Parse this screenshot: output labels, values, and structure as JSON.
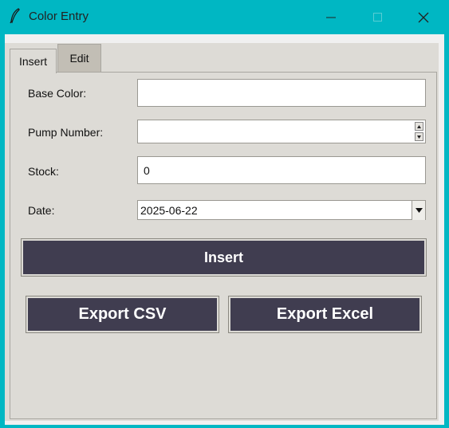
{
  "window": {
    "title": "Color Entry",
    "accent_color": "#00b7c3",
    "icon": "feather-icon"
  },
  "tabs": [
    {
      "label": "Insert",
      "selected": true
    },
    {
      "label": "Edit",
      "selected": false
    }
  ],
  "form": {
    "base_color": {
      "label": "Base Color:",
      "value": ""
    },
    "pump_number": {
      "label": "Pump Number:",
      "value": ""
    },
    "stock": {
      "label": "Stock:",
      "value": "0"
    },
    "date": {
      "label": "Date:",
      "value": "2025-06-22"
    }
  },
  "buttons": {
    "insert": "Insert",
    "export_csv": "Export CSV",
    "export_excel": "Export Excel",
    "color": "#403d50"
  }
}
